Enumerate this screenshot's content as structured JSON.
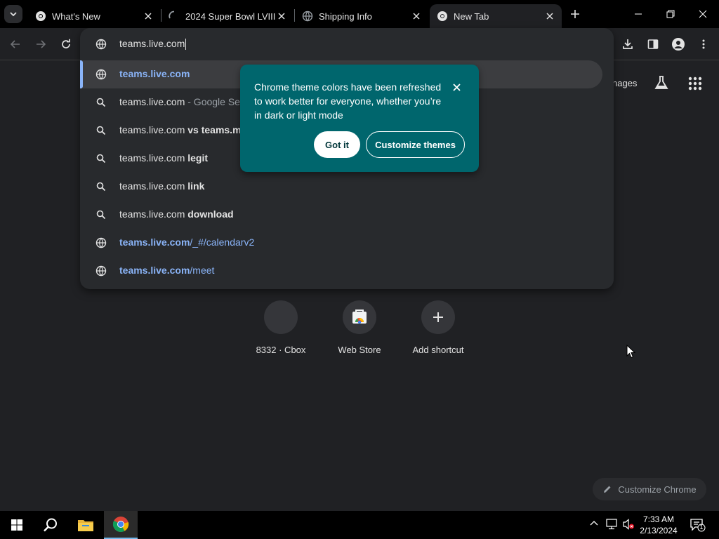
{
  "tabs": [
    {
      "title": "What's New",
      "favicon": "chrome-icon",
      "active": false
    },
    {
      "title": "2024 Super Bowl LVIII",
      "favicon": "loading-spinner-icon",
      "active": false
    },
    {
      "title": "Shipping Info",
      "favicon": "globe-icon",
      "active": false
    },
    {
      "title": "New Tab",
      "favicon": "chrome-icon",
      "active": true
    }
  ],
  "omnibox": {
    "value": "teams.live.com",
    "suggestions": [
      {
        "kind": "url",
        "bold": "teams.live.com",
        "rest": "",
        "icon": "globe-icon"
      },
      {
        "kind": "search",
        "text": "teams.live.com",
        "suffix": " - Google Sea",
        "icon": "search-icon"
      },
      {
        "kind": "search",
        "text": "teams.live.com",
        "bold": " vs teams.mi",
        "icon": "search-icon"
      },
      {
        "kind": "search",
        "text": "teams.live.com",
        "bold": " legit",
        "icon": "search-icon"
      },
      {
        "kind": "search",
        "text": "teams.live.com",
        "bold": " link",
        "icon": "search-icon"
      },
      {
        "kind": "search",
        "text": "teams.live.com",
        "bold": " download",
        "icon": "search-icon"
      },
      {
        "kind": "url",
        "bold": "teams.live.com",
        "rest": "/_#/calendarv2",
        "icon": "globe-icon"
      },
      {
        "kind": "url",
        "bold": "teams.live.com",
        "rest": "/meet",
        "icon": "globe-icon"
      }
    ]
  },
  "ntp": {
    "images_label": "nages",
    "shortcuts": [
      {
        "label": "8332 · Cbox"
      },
      {
        "label": "Web Store"
      },
      {
        "label": "Add shortcut"
      }
    ],
    "customize_chrome": "Customize Chrome"
  },
  "bubble": {
    "message": "Chrome theme colors have been refreshed to work better for everyone, whether you’re in dark or light mode",
    "got_it": "Got it",
    "customize": "Customize themes"
  },
  "taskbar": {
    "time": "7:33 AM",
    "date": "2/13/2024",
    "notification_count": "1"
  },
  "colors": {
    "bubble": "#00666d",
    "link": "#8ab4f8",
    "background": "#202124"
  }
}
